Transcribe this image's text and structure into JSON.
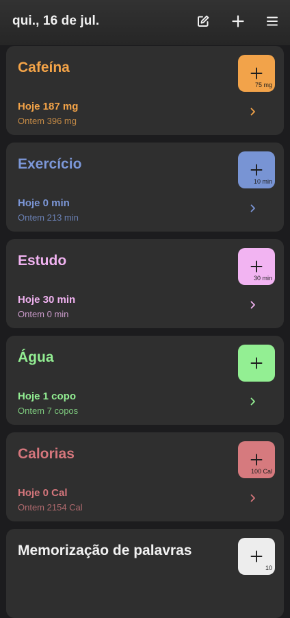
{
  "header": {
    "date": "qui., 16 de jul.",
    "icons": [
      "edit-icon",
      "plus-icon",
      "menu-icon"
    ]
  },
  "trackers": [
    {
      "title": "Cafeína",
      "today": "Hoje 187 mg",
      "yesterday": "Ontem 396 mg",
      "add_amount": "75 mg",
      "accent": "#f2a34a",
      "text_color": "#f4a448",
      "sub_color": "#c48a46"
    },
    {
      "title": "Exercício",
      "today": "Hoje 0 min",
      "yesterday": "Ontem 213 min",
      "add_amount": "10 min",
      "accent": "#7894d4",
      "text_color": "#7c97d8",
      "sub_color": "#6a80b4"
    },
    {
      "title": "Estudo",
      "today": "Hoje 30 min",
      "yesterday": "Ontem 0 min",
      "add_amount": "30 min",
      "accent": "#f2b4f2",
      "text_color": "#f0b2f0",
      "sub_color": "#c99ac9"
    },
    {
      "title": "Água",
      "today": "Hoje 1 copo",
      "yesterday": "Ontem 7 copos",
      "add_amount": "",
      "accent": "#93ef93",
      "text_color": "#93ef93",
      "sub_color": "#7ec97e"
    },
    {
      "title": "Calorias",
      "today": "Hoje 0 Cal",
      "yesterday": "Ontem 2154 Cal",
      "add_amount": "100 Cal",
      "accent": "#d67a7e",
      "text_color": "#d5767c",
      "sub_color": "#b06a6e"
    },
    {
      "title": "Memorização de palavras",
      "today": "",
      "yesterday": "",
      "add_amount": "10",
      "accent": "#ededed",
      "text_color": "#f2f2f2",
      "sub_color": "#bdbdbd"
    }
  ]
}
